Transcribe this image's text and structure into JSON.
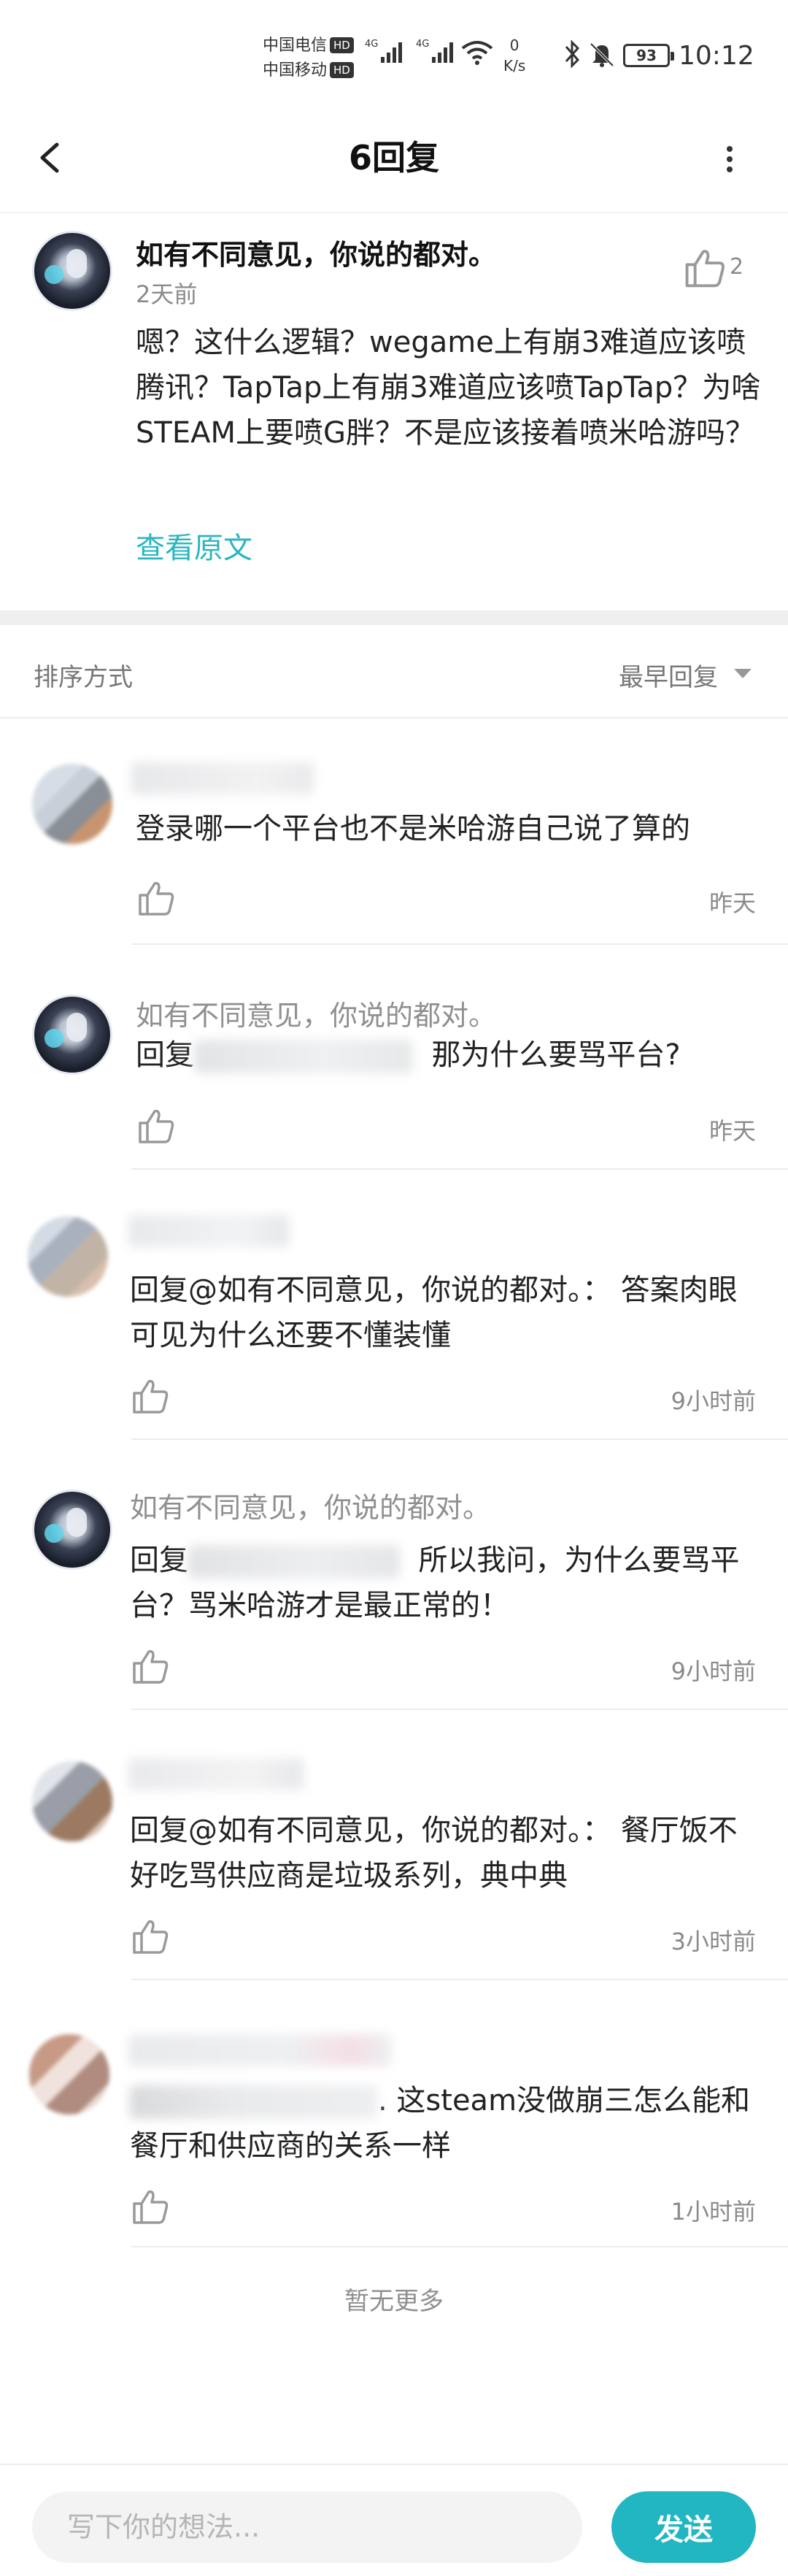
{
  "status_bar": {
    "carrier1": "中国电信",
    "carrier2": "中国移动",
    "hd": "HD",
    "net_type": "4G",
    "net_speed_value": "0",
    "net_speed_unit": "K/s",
    "battery": "93",
    "time": "10:12",
    "icons": [
      "signal-icon",
      "wifi-icon",
      "bluetooth-icon",
      "mute-icon",
      "battery-icon"
    ]
  },
  "header": {
    "title": "6回复",
    "back_icon": "chevron-left-icon",
    "more_icon": "more-vertical-icon"
  },
  "post": {
    "author": "如有不同意见，你说的都对。",
    "time": "2天前",
    "likes": "2",
    "body": "嗯？这什么逻辑？wegame上有崩3难道应该喷腾讯？TapTap上有崩3难道应该喷TapTap？为啥STEAM上要喷G胖？不是应该接着喷米哈游吗？",
    "view_original": "查看原文"
  },
  "sort": {
    "label": "排序方式",
    "value": "最早回复"
  },
  "replies": [
    {
      "text": "登录哪一个平台也不是米哈游自己说了算的",
      "time": "昨天"
    },
    {
      "name": "如有不同意见，你说的都对。",
      "prefix": "回复",
      "suffix": "那为什么要骂平台?",
      "time": "昨天"
    },
    {
      "text": "回复@如有不同意见，你说的都对。：  答案肉眼可见为什么还要不懂装懂",
      "time": "9小时前"
    },
    {
      "name": "如有不同意见，你说的都对。",
      "prefix": "回复",
      "suffix": "所以我问，为什么要骂平台？骂米哈游才是最正常的！",
      "time": "9小时前"
    },
    {
      "text": "回复@如有不同意见，你说的都对。：  餐厅饭不好吃骂供应商是垃圾系列，典中典",
      "time": "3小时前"
    },
    {
      "suffix": ". 这steam没做崩三怎么能和餐厅和供应商的关系一样",
      "time": "1小时前"
    }
  ],
  "no_more": "暂无更多",
  "bottom": {
    "placeholder": "写下你的想法...",
    "send": "发送"
  }
}
